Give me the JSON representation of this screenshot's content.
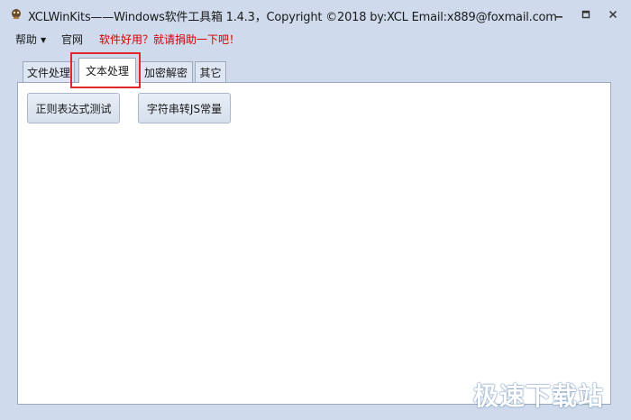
{
  "window": {
    "title": "XCLWinKits——Windows软件工具箱   1.4.3，Copyright ©2018 by:XCL Email:x889@foxmail.com",
    "icon": "app-icon",
    "controls": [
      "minimize-icon",
      "maximize-icon",
      "close-icon"
    ]
  },
  "menu": {
    "help": "帮助",
    "site": "官网",
    "donate": "软件好用？就请捐助一下吧！"
  },
  "tabs": [
    {
      "label": "文件处理",
      "selected": false
    },
    {
      "label": "文本处理",
      "selected": true
    },
    {
      "label": "加密解密",
      "selected": false
    },
    {
      "label": "其它",
      "selected": false
    }
  ],
  "panel": {
    "buttons": [
      {
        "label": "正则表达式测试"
      },
      {
        "label": "字符串转JS常量"
      }
    ]
  },
  "watermark": "极速下载站",
  "colors": {
    "chrome": "#cfdbec",
    "donate_text": "#d40000",
    "highlight": "#e0252b"
  }
}
